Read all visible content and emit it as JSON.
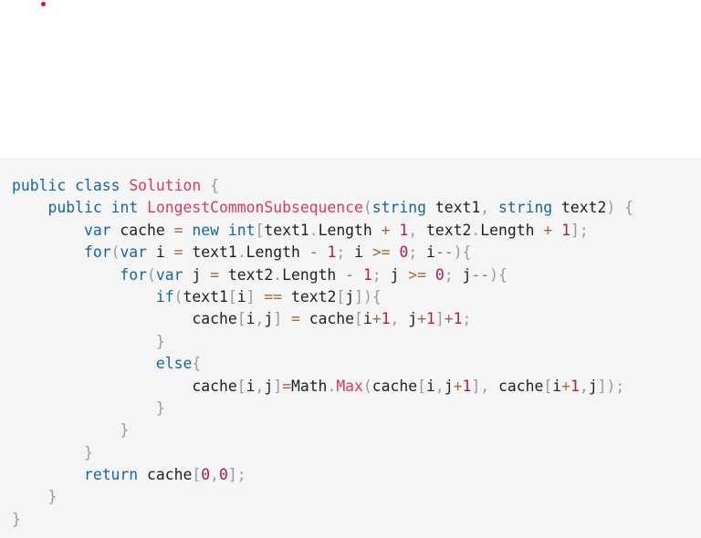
{
  "code": {
    "language": "csharp",
    "lines": [
      [
        [
          "kw",
          "public"
        ],
        [
          "id",
          " "
        ],
        [
          "kw",
          "class"
        ],
        [
          "id",
          " "
        ],
        [
          "cls",
          "Solution"
        ],
        [
          "id",
          " "
        ],
        [
          "p",
          "{"
        ]
      ],
      [
        [
          "id",
          "    "
        ],
        [
          "kw",
          "public"
        ],
        [
          "id",
          " "
        ],
        [
          "ty",
          "int"
        ],
        [
          "id",
          " "
        ],
        [
          "fn",
          "LongestCommonSubsequence"
        ],
        [
          "p",
          "("
        ],
        [
          "ty",
          "string"
        ],
        [
          "id",
          " text1"
        ],
        [
          "p",
          ","
        ],
        [
          "id",
          " "
        ],
        [
          "ty",
          "string"
        ],
        [
          "id",
          " text2"
        ],
        [
          "p",
          ")"
        ],
        [
          "id",
          " "
        ],
        [
          "p",
          "{"
        ]
      ],
      [
        [
          "id",
          "        "
        ],
        [
          "kw",
          "var"
        ],
        [
          "id",
          " cache "
        ],
        [
          "op",
          "="
        ],
        [
          "id",
          " "
        ],
        [
          "kw",
          "new"
        ],
        [
          "id",
          " "
        ],
        [
          "ty",
          "int"
        ],
        [
          "p",
          "["
        ],
        [
          "id",
          "text1"
        ],
        [
          "p",
          "."
        ],
        [
          "id",
          "Length "
        ],
        [
          "op",
          "+"
        ],
        [
          "id",
          " "
        ],
        [
          "num",
          "1"
        ],
        [
          "p",
          ","
        ],
        [
          "id",
          " text2"
        ],
        [
          "p",
          "."
        ],
        [
          "id",
          "Length "
        ],
        [
          "op",
          "+"
        ],
        [
          "id",
          " "
        ],
        [
          "num",
          "1"
        ],
        [
          "p",
          "];"
        ]
      ],
      [
        [
          "id",
          "        "
        ],
        [
          "kw",
          "for"
        ],
        [
          "p",
          "("
        ],
        [
          "kw",
          "var"
        ],
        [
          "id",
          " i "
        ],
        [
          "op",
          "="
        ],
        [
          "id",
          " text1"
        ],
        [
          "p",
          "."
        ],
        [
          "id",
          "Length "
        ],
        [
          "op",
          "-"
        ],
        [
          "id",
          " "
        ],
        [
          "num",
          "1"
        ],
        [
          "p",
          ";"
        ],
        [
          "id",
          " i "
        ],
        [
          "op",
          ">="
        ],
        [
          "id",
          " "
        ],
        [
          "num",
          "0"
        ],
        [
          "p",
          ";"
        ],
        [
          "id",
          " i"
        ],
        [
          "op",
          "--"
        ],
        [
          "p",
          "){"
        ]
      ],
      [
        [
          "id",
          "            "
        ],
        [
          "kw",
          "for"
        ],
        [
          "p",
          "("
        ],
        [
          "kw",
          "var"
        ],
        [
          "id",
          " j "
        ],
        [
          "op",
          "="
        ],
        [
          "id",
          " text2"
        ],
        [
          "p",
          "."
        ],
        [
          "id",
          "Length "
        ],
        [
          "op",
          "-"
        ],
        [
          "id",
          " "
        ],
        [
          "num",
          "1"
        ],
        [
          "p",
          ";"
        ],
        [
          "id",
          " j "
        ],
        [
          "op",
          ">="
        ],
        [
          "id",
          " "
        ],
        [
          "num",
          "0"
        ],
        [
          "p",
          ";"
        ],
        [
          "id",
          " j"
        ],
        [
          "op",
          "--"
        ],
        [
          "p",
          "){"
        ]
      ],
      [
        [
          "id",
          "                "
        ],
        [
          "kw",
          "if"
        ],
        [
          "p",
          "("
        ],
        [
          "id",
          "text1"
        ],
        [
          "p",
          "["
        ],
        [
          "id",
          "i"
        ],
        [
          "p",
          "]"
        ],
        [
          "id",
          " "
        ],
        [
          "op",
          "=="
        ],
        [
          "id",
          " text2"
        ],
        [
          "p",
          "["
        ],
        [
          "id",
          "j"
        ],
        [
          "p",
          "]){"
        ]
      ],
      [
        [
          "id",
          "                    cache"
        ],
        [
          "p",
          "["
        ],
        [
          "id",
          "i"
        ],
        [
          "p",
          ","
        ],
        [
          "id",
          "j"
        ],
        [
          "p",
          "]"
        ],
        [
          "id",
          " "
        ],
        [
          "op",
          "="
        ],
        [
          "id",
          " cache"
        ],
        [
          "p",
          "["
        ],
        [
          "id",
          "i"
        ],
        [
          "op",
          "+"
        ],
        [
          "num",
          "1"
        ],
        [
          "p",
          ","
        ],
        [
          "id",
          " j"
        ],
        [
          "op",
          "+"
        ],
        [
          "num",
          "1"
        ],
        [
          "p",
          "]"
        ],
        [
          "op",
          "+"
        ],
        [
          "num",
          "1"
        ],
        [
          "p",
          ";"
        ]
      ],
      [
        [
          "id",
          "                "
        ],
        [
          "p",
          "}"
        ]
      ],
      [
        [
          "id",
          "                "
        ],
        [
          "kw",
          "else"
        ],
        [
          "p",
          "{"
        ]
      ],
      [
        [
          "id",
          "                    cache"
        ],
        [
          "p",
          "["
        ],
        [
          "id",
          "i"
        ],
        [
          "p",
          ","
        ],
        [
          "id",
          "j"
        ],
        [
          "p",
          "]"
        ],
        [
          "op",
          "="
        ],
        [
          "id",
          "Math"
        ],
        [
          "p",
          "."
        ],
        [
          "fn",
          "Max"
        ],
        [
          "p",
          "("
        ],
        [
          "id",
          "cache"
        ],
        [
          "p",
          "["
        ],
        [
          "id",
          "i"
        ],
        [
          "p",
          ","
        ],
        [
          "id",
          "j"
        ],
        [
          "op",
          "+"
        ],
        [
          "num",
          "1"
        ],
        [
          "p",
          "],"
        ],
        [
          "id",
          " cache"
        ],
        [
          "p",
          "["
        ],
        [
          "id",
          "i"
        ],
        [
          "op",
          "+"
        ],
        [
          "num",
          "1"
        ],
        [
          "p",
          ","
        ],
        [
          "id",
          "j"
        ],
        [
          "p",
          "]);"
        ]
      ],
      [
        [
          "id",
          "                "
        ],
        [
          "p",
          "}"
        ]
      ],
      [
        [
          "id",
          "            "
        ],
        [
          "p",
          "}"
        ]
      ],
      [
        [
          "id",
          "        "
        ],
        [
          "p",
          "}"
        ]
      ],
      [
        [
          "id",
          "        "
        ],
        [
          "kw",
          "return"
        ],
        [
          "id",
          " cache"
        ],
        [
          "p",
          "["
        ],
        [
          "num",
          "0"
        ],
        [
          "p",
          ","
        ],
        [
          "num",
          "0"
        ],
        [
          "p",
          "];"
        ]
      ],
      [
        [
          "id",
          "    "
        ],
        [
          "p",
          "}"
        ]
      ],
      [
        [
          "p",
          "}"
        ]
      ]
    ]
  },
  "colors": {
    "keyword": "#1565a6",
    "class_name": "#d93a5c",
    "number": "#b0185b",
    "punctuation": "#9a9a9a",
    "operator": "#a06a38",
    "identifier": "#1f1f1f",
    "code_background": "#f5f5f5",
    "marker": "#d7191c"
  }
}
